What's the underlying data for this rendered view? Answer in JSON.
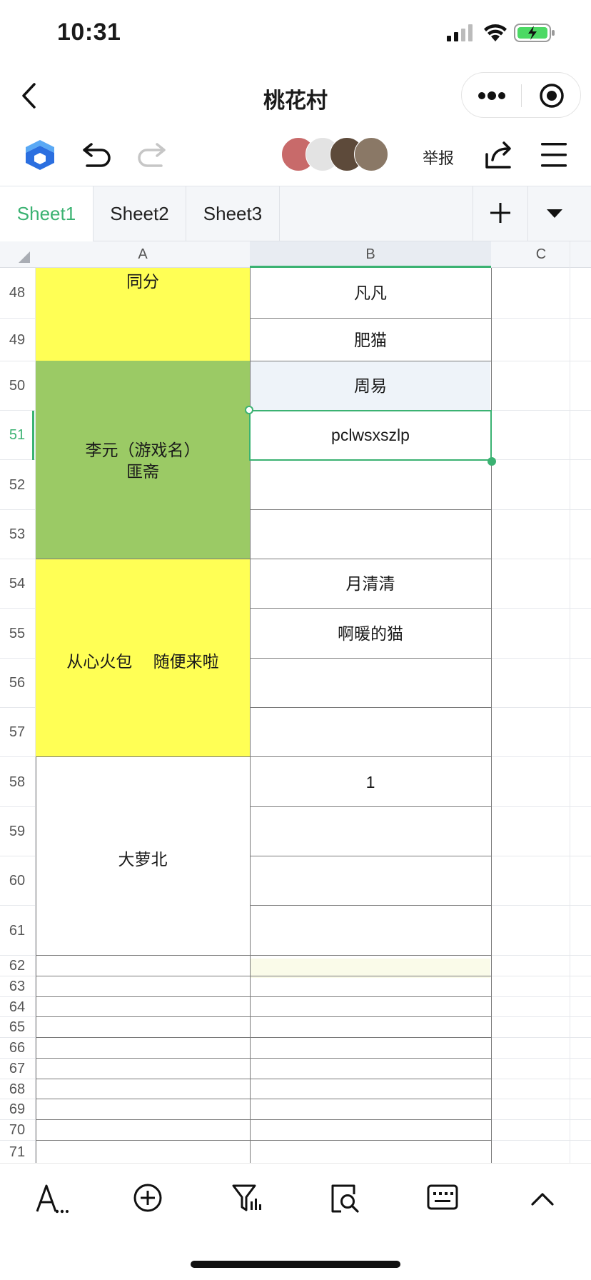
{
  "status_bar": {
    "time": "10:31"
  },
  "nav": {
    "title": "桃花村"
  },
  "toolbar": {
    "report_label": "举报"
  },
  "tabs": [
    {
      "label": "Sheet1",
      "active": true
    },
    {
      "label": "Sheet2",
      "active": false
    },
    {
      "label": "Sheet3",
      "active": false
    }
  ],
  "grid": {
    "columns": [
      "A",
      "B",
      "C"
    ],
    "row_numbers": [
      "48",
      "49",
      "50",
      "51",
      "52",
      "53",
      "54",
      "55",
      "56",
      "57",
      "58",
      "59",
      "60",
      "61",
      "62",
      "63",
      "64",
      "65",
      "66",
      "67",
      "68",
      "69",
      "70",
      "71"
    ],
    "selected_row": "51",
    "merged_a": [
      {
        "text": "同分",
        "fill": "#ffff55"
      },
      {
        "text": "李元（游戏名）\n匪斋",
        "fill": "#9bca65"
      },
      {
        "text": "从心火包　 随便来啦",
        "fill": "#ffff55"
      },
      {
        "text": "大萝北",
        "fill": "#ffffff"
      }
    ],
    "col_b": {
      "48": "凡凡",
      "49": "肥猫",
      "50": "周易",
      "51": "pclwsxszlp",
      "54": "月清清",
      "55": "啊暖的猫",
      "58": "1"
    }
  },
  "colors": {
    "accent": "#3bb272",
    "yellow_fill": "#ffff55",
    "green_fill": "#9bca65",
    "highlight_row": "#eef3f9"
  },
  "bottom_toolbar": [
    "text-format-icon",
    "insert-icon",
    "filter-icon",
    "find-icon",
    "keyboard-icon",
    "collapse-icon"
  ]
}
